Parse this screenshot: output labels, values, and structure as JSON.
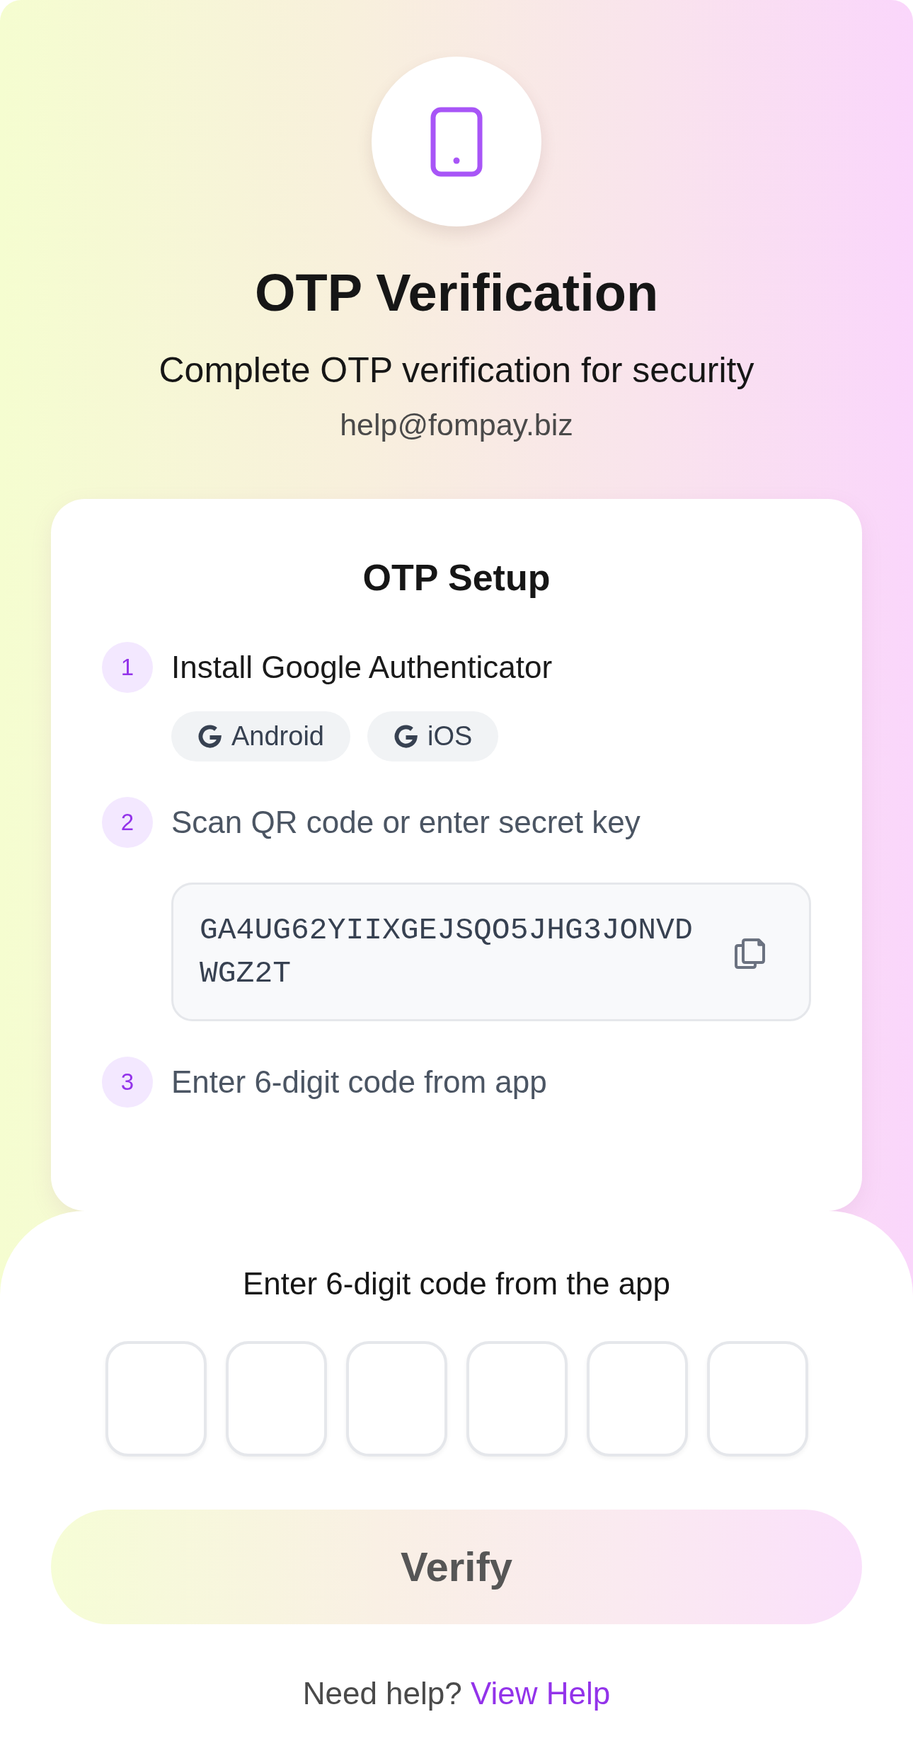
{
  "header": {
    "title": "OTP Verification",
    "subtitle": "Complete OTP verification for security",
    "email": "help@fompay.biz"
  },
  "setup": {
    "title": "OTP Setup",
    "steps": [
      {
        "number": "1",
        "kind": "apps",
        "text": "Install Google Authenticator",
        "apps": [
          "Android",
          "iOS"
        ]
      },
      {
        "number": "2",
        "kind": "secret",
        "text": "Scan QR code or enter secret key",
        "secret_key": "GA4UG62YIIXGEJSQO5JHG3JONVDWGZ2T"
      },
      {
        "number": "3",
        "kind": "plain",
        "text": "Enter 6-digit code from app"
      }
    ]
  },
  "code_entry": {
    "label": "Enter 6-digit code from the app",
    "digit_fields": [
      {
        "focused": false
      },
      {
        "focused": false
      },
      {
        "focused": false
      },
      {
        "focused": false
      },
      {
        "focused": false
      },
      {
        "focused": false
      }
    ]
  },
  "verify_button": {
    "label": "Verify",
    "disabled": true
  },
  "help": {
    "prompt": "Need help?",
    "link": "View Help"
  }
}
